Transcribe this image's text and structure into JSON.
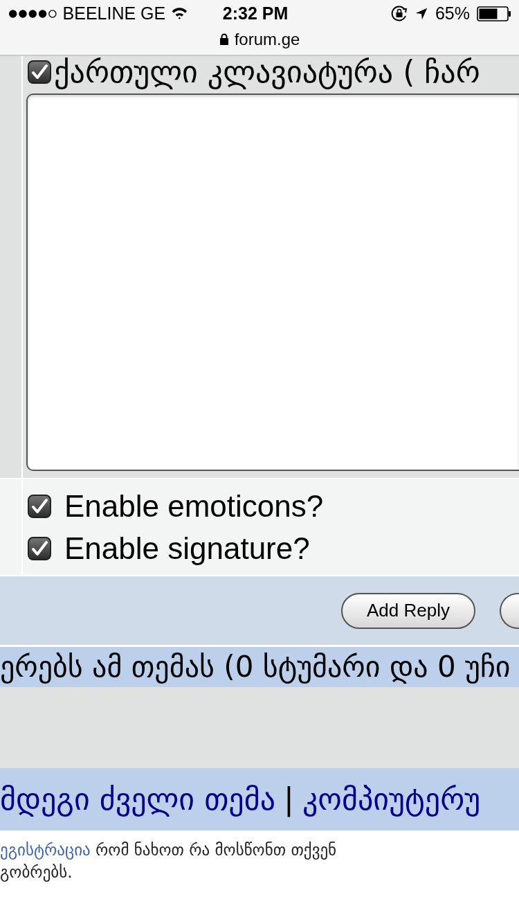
{
  "status_bar": {
    "carrier": "BEELINE GE",
    "time": "2:32 PM",
    "battery": "65%"
  },
  "address_bar": {
    "url": "forum.ge"
  },
  "keyboard_toggle": {
    "label": "ქართული კლავიატურა ( ჩარ",
    "checked": true
  },
  "options": [
    {
      "label": "Enable emoticons?",
      "checked": true
    },
    {
      "label": "Enable signature?",
      "checked": true
    }
  ],
  "buttons": [
    {
      "label": "Add Reply"
    }
  ],
  "viewers_bar": {
    "text": "ერებს ამ თემას (0 სტუმარი და 0 უჩი"
  },
  "topic_nav": {
    "links": [
      "მდეგი ძველი თემა",
      "კომპიუტერუ"
    ],
    "separator": "|"
  },
  "footer_note": {
    "link": "ეგისტრაცია",
    "text": "რომ ნახოთ რა მოსწონთ თქვენ გობრებს."
  }
}
